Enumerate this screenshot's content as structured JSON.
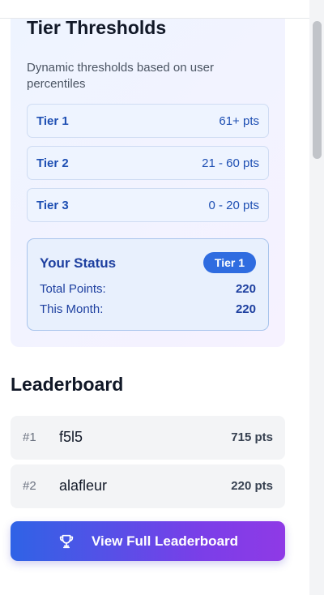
{
  "tiers_panel": {
    "title": "Tier Thresholds",
    "description": "Dynamic thresholds based on user percentiles",
    "tiers": [
      {
        "name": "Tier 1",
        "range": "61+ pts"
      },
      {
        "name": "Tier 2",
        "range": "21 - 60 pts"
      },
      {
        "name": "Tier 3",
        "range": "0 - 20 pts"
      }
    ],
    "status": {
      "title": "Your Status",
      "badge": "Tier 1",
      "total_points_label": "Total Points:",
      "total_points_value": "220",
      "this_month_label": "This Month:",
      "this_month_value": "220"
    }
  },
  "leaderboard": {
    "title": "Leaderboard",
    "entries": [
      {
        "rank": "#1",
        "user": "f5l5",
        "points": "715 pts"
      },
      {
        "rank": "#2",
        "user": "alafleur",
        "points": "220 pts"
      }
    ],
    "view_full_label": "View Full Leaderboard",
    "button_icon": "trophy-icon"
  },
  "colors": {
    "accent_blue": "#2f6ce0",
    "tier_text": "#1e4fb3",
    "button_gradient_start": "#2f63e6",
    "button_gradient_end": "#8f3ae6"
  }
}
